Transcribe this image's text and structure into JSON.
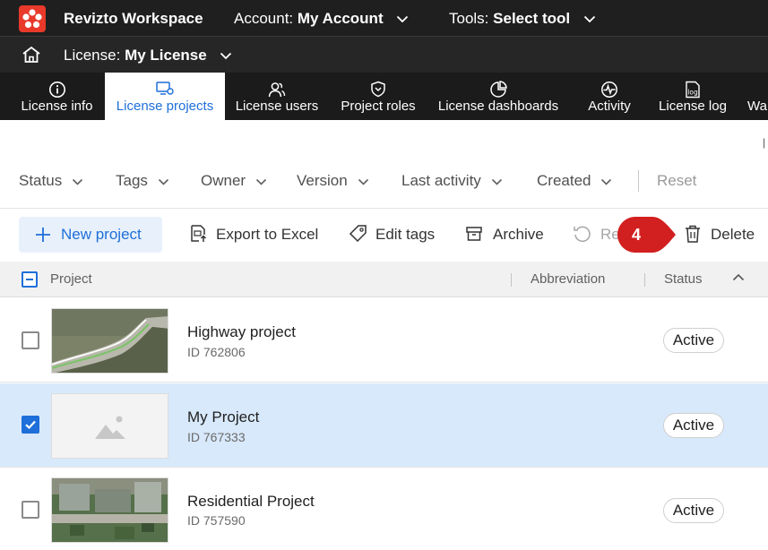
{
  "topbar": {
    "app_name": "Revizto Workspace",
    "account_label": "Account:",
    "account_value": "My Account",
    "tools_label": "Tools:",
    "tools_value": "Select tool"
  },
  "license_bar": {
    "license_label": "License:",
    "license_value": "My License"
  },
  "nav_tabs": [
    {
      "label": "License info",
      "icon": "info-icon",
      "active": false
    },
    {
      "label": "License projects",
      "icon": "projects-icon",
      "active": true
    },
    {
      "label": "License users",
      "icon": "users-icon",
      "active": false
    },
    {
      "label": "Project roles",
      "icon": "shield-icon",
      "active": false
    },
    {
      "label": "License dashboards",
      "icon": "pie-chart-icon",
      "active": false
    },
    {
      "label": "Activity",
      "icon": "activity-icon",
      "active": false
    },
    {
      "label": "License log",
      "icon": "log-icon",
      "active": false
    },
    {
      "label": "Wa",
      "icon": "",
      "active": false
    }
  ],
  "filters": {
    "items": [
      "Status",
      "Tags",
      "Owner",
      "Version",
      "Last activity",
      "Created"
    ],
    "reset": "Reset"
  },
  "actions": {
    "new_project": "New project",
    "export": "Export to Excel",
    "edit_tags": "Edit tags",
    "archive": "Archive",
    "restore_partial": "Re",
    "delete": "Delete",
    "step_badge": "4"
  },
  "table": {
    "columns": {
      "project": "Project",
      "abbreviation": "Abbreviation",
      "status": "Status"
    },
    "rows": [
      {
        "name": "Highway project",
        "id": "ID 762806",
        "status": "Active",
        "selected": false,
        "thumbnail": "highway-render"
      },
      {
        "name": "My Project",
        "id": "ID 767333",
        "status": "Active",
        "selected": true,
        "thumbnail": "placeholder-image"
      },
      {
        "name": "Residential Project",
        "id": "ID 757590",
        "status": "Active",
        "selected": false,
        "thumbnail": "residential-render"
      }
    ]
  },
  "colors": {
    "brand_red": "#e8392a",
    "accent_blue": "#1e6fd9",
    "selected_row": "#d8e9fb",
    "badge_red": "#d21f1f"
  }
}
